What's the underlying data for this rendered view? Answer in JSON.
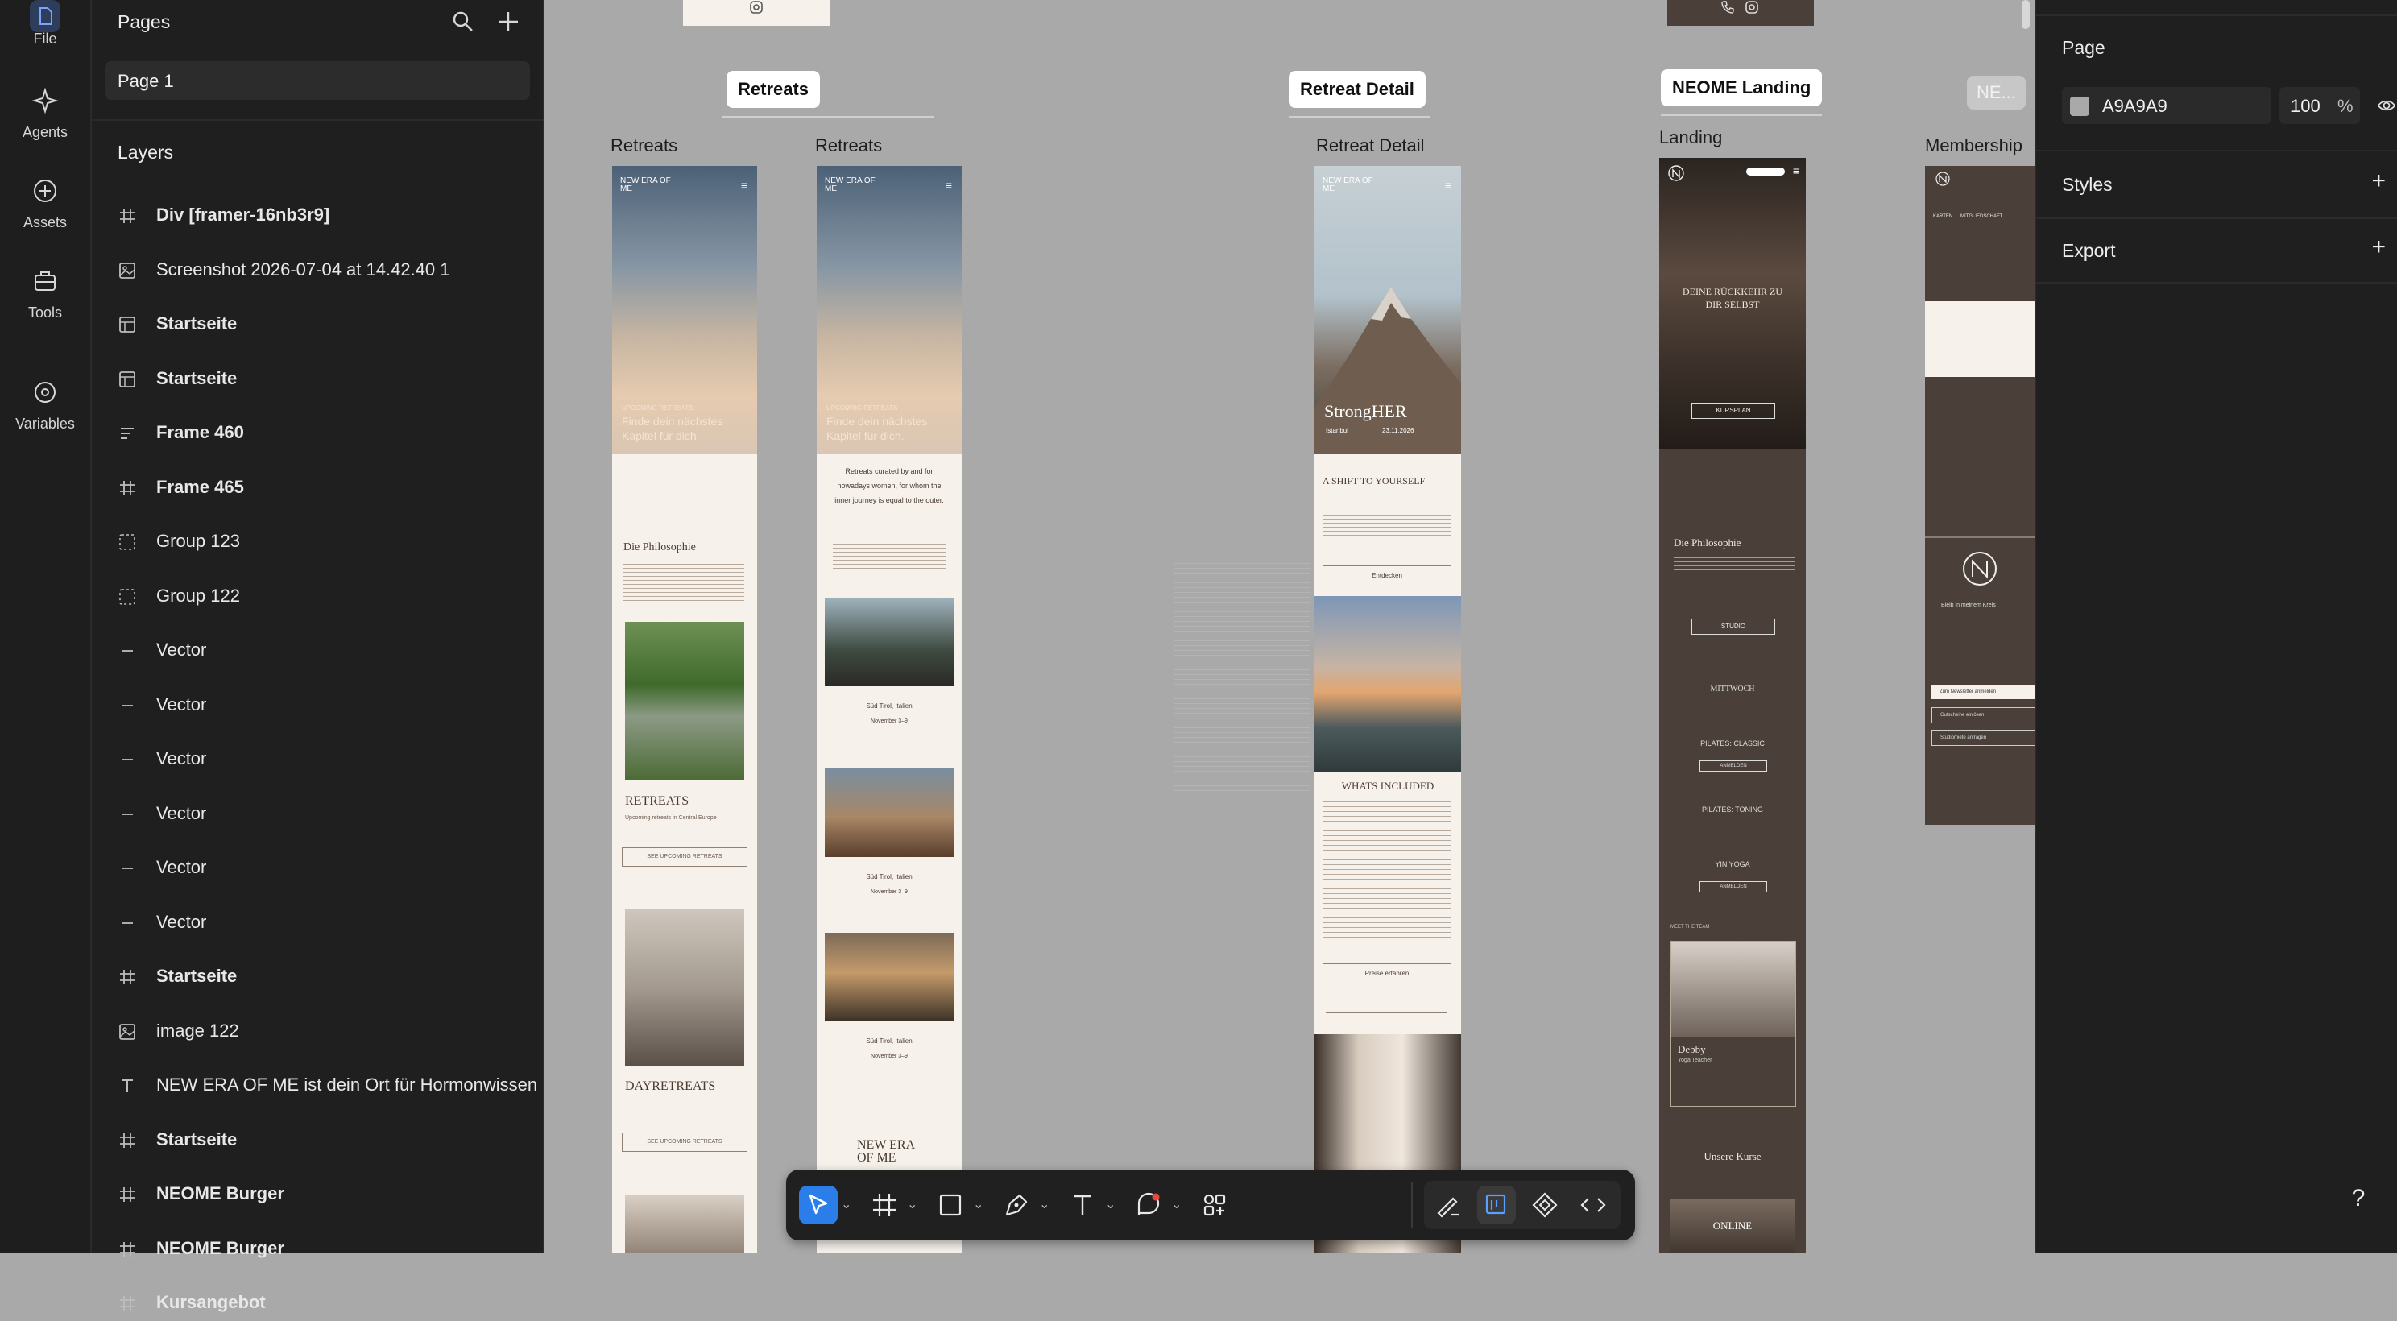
{
  "rail": {
    "file": "File",
    "agents": "Agents",
    "assets": "Assets",
    "tools": "Tools",
    "variables": "Variables"
  },
  "sidebar": {
    "pages_title": "Pages",
    "current_page": "Page 1",
    "layers_title": "Layers",
    "layers": [
      {
        "icon": "frame-icon",
        "name": "Div [framer-16nb3r9]",
        "bold": true
      },
      {
        "icon": "image-icon",
        "name": "Screenshot 2026-07-04 at 14.42.40 1",
        "bold": false
      },
      {
        "icon": "component-icon",
        "name": "Startseite",
        "bold": true
      },
      {
        "icon": "component-icon",
        "name": "Startseite",
        "bold": true
      },
      {
        "icon": "stack-icon",
        "name": "Frame 460",
        "bold": true
      },
      {
        "icon": "frame-icon",
        "name": "Frame 465",
        "bold": true
      },
      {
        "icon": "group-icon",
        "name": "Group 123",
        "bold": false
      },
      {
        "icon": "group-icon",
        "name": "Group 122",
        "bold": false
      },
      {
        "icon": "vector-icon",
        "name": "Vector",
        "bold": false
      },
      {
        "icon": "vector-icon",
        "name": "Vector",
        "bold": false
      },
      {
        "icon": "vector-icon",
        "name": "Vector",
        "bold": false
      },
      {
        "icon": "vector-icon",
        "name": "Vector",
        "bold": false
      },
      {
        "icon": "vector-icon",
        "name": "Vector",
        "bold": false
      },
      {
        "icon": "vector-icon",
        "name": "Vector",
        "bold": false
      },
      {
        "icon": "frame-icon",
        "name": "Startseite",
        "bold": true
      },
      {
        "icon": "image-icon",
        "name": "image 122",
        "bold": false
      },
      {
        "icon": "text-icon",
        "name": "NEW ERA OF ME ist dein Ort für Hormonwissen",
        "bold": false
      },
      {
        "icon": "frame-icon",
        "name": "Startseite",
        "bold": true
      },
      {
        "icon": "frame-icon",
        "name": "NEOME Burger",
        "bold": true
      },
      {
        "icon": "frame-icon",
        "name": "NEOME Burger",
        "bold": true
      },
      {
        "icon": "frame-icon",
        "name": "Kursangebot",
        "bold": true
      }
    ]
  },
  "right_panel": {
    "page_title": "Page",
    "fill_hex": "A9A9A9",
    "fill_opacity": "100",
    "percent": "%",
    "styles_label": "Styles",
    "export_label": "Export"
  },
  "canvas": {
    "tags": {
      "retreats": "Retreats",
      "retreat_detail": "Retreat Detail",
      "neome_landing": "NEOME Landing",
      "ne": "NE..."
    },
    "frame_labels": {
      "retreats_1": "Retreats",
      "retreats_2": "Retreats",
      "retreat_detail": "Retreat Detail",
      "landing": "Landing",
      "membership": "Membership"
    },
    "frame_text": {
      "brand": "NEW ERA OF ME",
      "upcoming": "UPCOMING RETREATS",
      "hero_line": "Finde dein nächstes Kapitel für dich.",
      "philosophie": "Die Philosophie",
      "retreats_heading": "RETREATS",
      "retreats_sub": "Upcoming retreats in Central Europe",
      "see_btn": "SEE UPCOMING RETREATS",
      "dayretreats": "DAYRETREATS",
      "curated": "Retreats curated by and for nowadays women, for whom the inner journey is equal to the outer.",
      "sued_tirol": "Süd Tirol, Italien",
      "november": "November 3–9",
      "strongher": "StrongHER",
      "istanbul": "Istanbul",
      "date": "23.11.2026",
      "shift": "A SHIFT TO YOURSELF",
      "entdecken": "Entdecken",
      "whats_included": "WHATS INCLUDED",
      "preise": "Preise erfahren",
      "rueckkehr": "DEINE RÜCKKEHR ZU DIR SELBST",
      "kursplan": "KURSPLAN",
      "studio": "STUDIO",
      "mittwoch": "MITTWOCH",
      "pilates_classic": "PILATES: CLASSIC",
      "pilates_toning": "PILATES: TONING",
      "yin_yoga": "YIN YOGA",
      "anmelden": "ANMELDEN",
      "meet_team": "MEET THE TEAM",
      "debby": "Debby",
      "yoga_teacher": "Yoga Teacher",
      "unsere_kurse": "Unsere Kurse",
      "online": "ONLINE",
      "karten": "KARTEN",
      "mitgliedschaft": "MITGLIEDSCHAFT",
      "bleib": "Bleib in meinem Kreis",
      "newsletter": "Zum Newsletter anmelden",
      "gutscheine": "Gutscheine einlösen",
      "studiomiete": "Studiomiete anfragen"
    }
  },
  "toolbar": {
    "tools": [
      "pointer-tool",
      "frame-tool",
      "shape-tool",
      "pen-tool",
      "text-tool",
      "comment-tool",
      "components-tool"
    ],
    "right_tools": [
      "draw-mode",
      "design-mode",
      "prototype-mode",
      "code-mode"
    ]
  },
  "help": "?"
}
